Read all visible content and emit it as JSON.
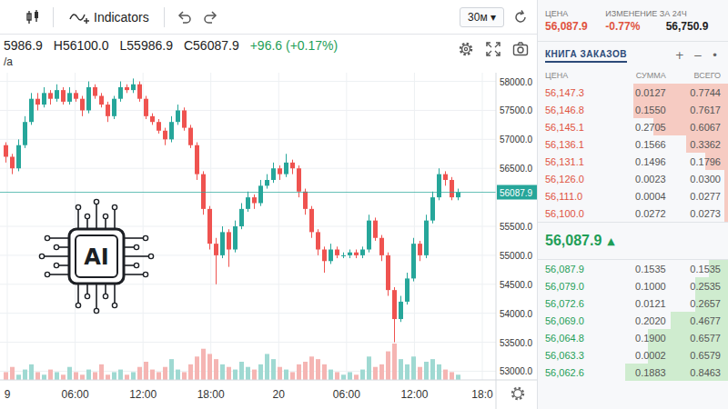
{
  "toolbar": {
    "indicators": "Indicators",
    "interval": "30м ▾"
  },
  "ohlc": {
    "open": "5986.9",
    "high": "H56100.0",
    "low": "L55986.9",
    "close": "C56087.9",
    "change": "+96.6 (+0.17%)"
  },
  "legend": "/a",
  "chart": {
    "price_ticks": [
      "58000.0",
      "57500.0",
      "57000.0",
      "56500.0",
      "55500.0",
      "55000.0",
      "54500.0",
      "54000.0",
      "53500.0",
      "53000.0"
    ],
    "last_price": "56087.9",
    "time_ticks": [
      "9",
      "06:00",
      "12:00",
      "18:00",
      "20",
      "06:00",
      "12:00",
      "18:0"
    ],
    "candles": [
      [
        56900,
        56950,
        56600,
        56700
      ],
      [
        56700,
        56750,
        56400,
        56500
      ],
      [
        56500,
        57000,
        56450,
        56900
      ],
      [
        56900,
        57400,
        56850,
        57300
      ],
      [
        57300,
        57800,
        57250,
        57700
      ],
      [
        57700,
        57800,
        57500,
        57600
      ],
      [
        57600,
        57900,
        57550,
        57800
      ],
      [
        57800,
        57850,
        57600,
        57700
      ],
      [
        57700,
        57950,
        57650,
        57850
      ],
      [
        57850,
        57900,
        57600,
        57650
      ],
      [
        57650,
        57900,
        57600,
        57800
      ],
      [
        57800,
        57850,
        57650,
        57700
      ],
      [
        57700,
        57750,
        57400,
        57500
      ],
      [
        57500,
        58000,
        57450,
        57900
      ],
      [
        57900,
        57950,
        57700,
        57750
      ],
      [
        57750,
        57800,
        57550,
        57600
      ],
      [
        57600,
        57650,
        57300,
        57400
      ],
      [
        57400,
        57750,
        57350,
        57700
      ],
      [
        57700,
        58000,
        57650,
        57900
      ],
      [
        57900,
        57950,
        57800,
        57850
      ],
      [
        57850,
        58050,
        57800,
        57950
      ],
      [
        57950,
        58000,
        57650,
        57700
      ],
      [
        57700,
        57750,
        57350,
        57400
      ],
      [
        57400,
        57450,
        57250,
        57300
      ],
      [
        57300,
        57350,
        57100,
        57150
      ],
      [
        57150,
        57200,
        56900,
        57000
      ],
      [
        57000,
        57400,
        56950,
        57300
      ],
      [
        57300,
        57600,
        57250,
        57500
      ],
      [
        57500,
        57550,
        57150,
        57200
      ],
      [
        57200,
        57250,
        56850,
        56900
      ],
      [
        56900,
        56950,
        56300,
        56400
      ],
      [
        56400,
        56450,
        55700,
        55800
      ],
      [
        55800,
        55850,
        55100,
        55200
      ],
      [
        55200,
        55300,
        54500,
        55000
      ],
      [
        55000,
        55500,
        54950,
        55400
      ],
      [
        55400,
        55450,
        54800,
        55100
      ],
      [
        55100,
        55600,
        55050,
        55500
      ],
      [
        55500,
        55900,
        55450,
        55800
      ],
      [
        55800,
        56100,
        55750,
        56000
      ],
      [
        56000,
        56050,
        55800,
        55900
      ],
      [
        55900,
        56300,
        55850,
        56200
      ],
      [
        56200,
        56400,
        56150,
        56300
      ],
      [
        56300,
        56600,
        56250,
        56500
      ],
      [
        56500,
        56550,
        56300,
        56400
      ],
      [
        56400,
        56750,
        56350,
        56600
      ],
      [
        56600,
        56650,
        56400,
        56500
      ],
      [
        56500,
        56550,
        56000,
        56100
      ],
      [
        56100,
        56150,
        55700,
        55800
      ],
      [
        55800,
        55850,
        55300,
        55400
      ],
      [
        55400,
        55450,
        55000,
        55100
      ],
      [
        55100,
        55150,
        54700,
        54900
      ],
      [
        54900,
        55200,
        54850,
        55100
      ],
      [
        55100,
        55150,
        54950,
        55000
      ],
      [
        55000,
        55050,
        54950,
        55000
      ],
      [
        55000,
        55100,
        54950,
        55050
      ],
      [
        55050,
        55100,
        54950,
        55000
      ],
      [
        55000,
        55150,
        54950,
        55100
      ],
      [
        55100,
        55700,
        55050,
        55600
      ],
      [
        55600,
        55650,
        55250,
        55300
      ],
      [
        55300,
        55350,
        54900,
        55000
      ],
      [
        55000,
        55050,
        54300,
        54400
      ],
      [
        54400,
        54450,
        53500,
        53900
      ],
      [
        53900,
        54300,
        53850,
        54200
      ],
      [
        54200,
        54700,
        54150,
        54600
      ],
      [
        54600,
        55300,
        54550,
        55200
      ],
      [
        55200,
        55250,
        54900,
        55000
      ],
      [
        55000,
        55700,
        54950,
        55600
      ],
      [
        55600,
        56100,
        55550,
        56000
      ],
      [
        56000,
        56500,
        55950,
        56400
      ],
      [
        56400,
        56450,
        56200,
        56300
      ],
      [
        56300,
        56350,
        55950,
        56000
      ],
      [
        56000,
        56150,
        55950,
        56087.9
      ]
    ],
    "volumes": [
      3,
      5,
      2,
      4,
      6,
      3,
      2,
      4,
      3,
      2,
      5,
      3,
      2,
      4,
      3,
      6,
      2,
      3,
      4,
      2,
      3,
      5,
      7,
      4,
      3,
      5,
      8,
      4,
      3,
      6,
      9,
      12,
      10,
      8,
      6,
      5,
      4,
      7,
      5,
      4,
      6,
      10,
      8,
      5,
      4,
      3,
      6,
      7,
      9,
      8,
      6,
      4,
      3,
      2,
      3,
      2,
      4,
      9,
      5,
      6,
      11,
      14,
      8,
      6,
      9,
      5,
      7,
      8,
      6,
      4,
      3,
      2
    ]
  },
  "overlay": {
    "label": "AI"
  },
  "ticker": {
    "labels": [
      "ЦЕНА",
      "ИЗМЕНЕНИЕ ЗА 24Ч"
    ],
    "price": "56,087.9",
    "change": "-0.77%",
    "high": "56,750.9"
  },
  "order_book": {
    "title": "КНИГА ЗАКАЗОВ",
    "controls": [
      "+",
      "−",
      "•"
    ],
    "columns": [
      "ЦЕНА",
      "СУММА",
      "ВСЕГО"
    ],
    "asks": [
      {
        "price": "56,147.3",
        "amount": "0.0127",
        "total": "0.7744",
        "level": 0.91
      },
      {
        "price": "56,146.8",
        "amount": "0.1550",
        "total": "0.7617",
        "level": 0.9
      },
      {
        "price": "56,145.1",
        "amount": "0.2705",
        "total": "0.6067",
        "level": 0.71
      },
      {
        "price": "56,136.1",
        "amount": "0.1566",
        "total": "0.3362",
        "level": 0.4
      },
      {
        "price": "56,131.1",
        "amount": "0.1496",
        "total": "0.1796",
        "level": 0.21
      },
      {
        "price": "56,126.0",
        "amount": "0.0023",
        "total": "0.0300",
        "level": 0.04
      },
      {
        "price": "56,111.0",
        "amount": "0.0004",
        "total": "0.0277",
        "level": 0.033
      },
      {
        "price": "56,100.0",
        "amount": "0.0272",
        "total": "0.0273",
        "level": 0.032
      }
    ],
    "mid": {
      "price": "56,087.9",
      "arrow": "▲"
    },
    "bids": [
      {
        "price": "56,087.9",
        "amount": "0.1535",
        "total": "0.1535",
        "level": 0.18
      },
      {
        "price": "56,079.0",
        "amount": "0.1000",
        "total": "0.2535",
        "level": 0.3
      },
      {
        "price": "56,072.6",
        "amount": "0.0121",
        "total": "0.2657",
        "level": 0.31
      },
      {
        "price": "56,069.0",
        "amount": "0.2020",
        "total": "0.4677",
        "level": 0.55
      },
      {
        "price": "56,064.8",
        "amount": "0.1900",
        "total": "0.6577",
        "level": 0.77
      },
      {
        "price": "56,063.3",
        "amount": "0.0002",
        "total": "0.6579",
        "level": 0.77
      },
      {
        "price": "56,062.6",
        "amount": "0.1883",
        "total": "0.8463",
        "level": 0.99
      }
    ]
  }
}
